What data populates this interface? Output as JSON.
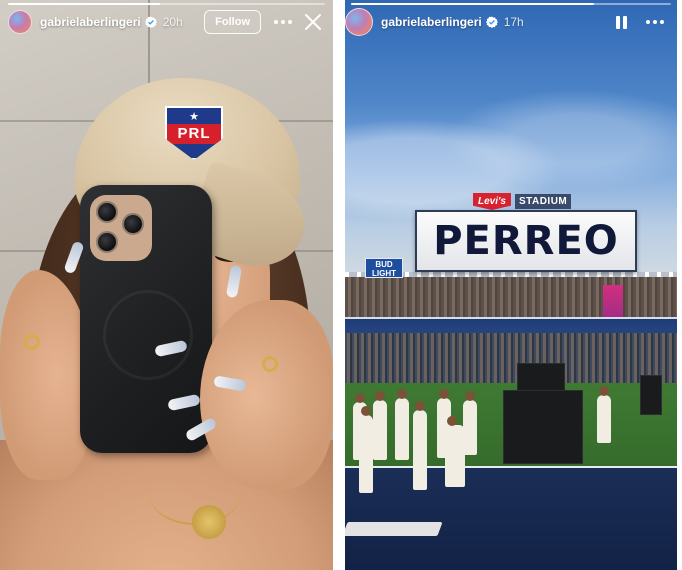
{
  "stories": [
    {
      "id": "left",
      "username": "gabrielaberlingeri",
      "verified": true,
      "time_ago": "20h",
      "follow_label": "Follow",
      "progress": 0.48,
      "cap_badge_text": "PRL"
    },
    {
      "id": "right",
      "username": "gabrielaberlingeri",
      "verified": true,
      "time_ago": "17h",
      "progress": 0.76,
      "billboard_text": "PERREO",
      "sponsor_levis": "Levi's",
      "sponsor_stadium": "STADIUM",
      "sponsor_bud_light": "BUD LIGHT"
    }
  ],
  "icons": {
    "verified": "verified-badge-icon",
    "more": "more-dots-icon",
    "close": "close-icon",
    "pause": "pause-icon"
  },
  "colors": {
    "verified_blue": "#3897f0",
    "overlay_text": "#ffffff",
    "badge_red": "#d6202b",
    "badge_blue": "#1f3a8a"
  }
}
